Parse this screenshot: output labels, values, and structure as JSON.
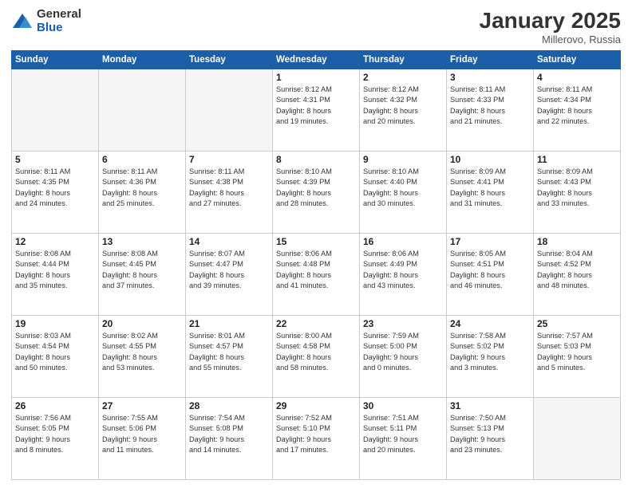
{
  "header": {
    "logo_general": "General",
    "logo_blue": "Blue",
    "month_title": "January 2025",
    "location": "Millerovo, Russia"
  },
  "days_of_week": [
    "Sunday",
    "Monday",
    "Tuesday",
    "Wednesday",
    "Thursday",
    "Friday",
    "Saturday"
  ],
  "weeks": [
    [
      {
        "day": "",
        "info": ""
      },
      {
        "day": "",
        "info": ""
      },
      {
        "day": "",
        "info": ""
      },
      {
        "day": "1",
        "info": "Sunrise: 8:12 AM\nSunset: 4:31 PM\nDaylight: 8 hours\nand 19 minutes."
      },
      {
        "day": "2",
        "info": "Sunrise: 8:12 AM\nSunset: 4:32 PM\nDaylight: 8 hours\nand 20 minutes."
      },
      {
        "day": "3",
        "info": "Sunrise: 8:11 AM\nSunset: 4:33 PM\nDaylight: 8 hours\nand 21 minutes."
      },
      {
        "day": "4",
        "info": "Sunrise: 8:11 AM\nSunset: 4:34 PM\nDaylight: 8 hours\nand 22 minutes."
      }
    ],
    [
      {
        "day": "5",
        "info": "Sunrise: 8:11 AM\nSunset: 4:35 PM\nDaylight: 8 hours\nand 24 minutes."
      },
      {
        "day": "6",
        "info": "Sunrise: 8:11 AM\nSunset: 4:36 PM\nDaylight: 8 hours\nand 25 minutes."
      },
      {
        "day": "7",
        "info": "Sunrise: 8:11 AM\nSunset: 4:38 PM\nDaylight: 8 hours\nand 27 minutes."
      },
      {
        "day": "8",
        "info": "Sunrise: 8:10 AM\nSunset: 4:39 PM\nDaylight: 8 hours\nand 28 minutes."
      },
      {
        "day": "9",
        "info": "Sunrise: 8:10 AM\nSunset: 4:40 PM\nDaylight: 8 hours\nand 30 minutes."
      },
      {
        "day": "10",
        "info": "Sunrise: 8:09 AM\nSunset: 4:41 PM\nDaylight: 8 hours\nand 31 minutes."
      },
      {
        "day": "11",
        "info": "Sunrise: 8:09 AM\nSunset: 4:43 PM\nDaylight: 8 hours\nand 33 minutes."
      }
    ],
    [
      {
        "day": "12",
        "info": "Sunrise: 8:08 AM\nSunset: 4:44 PM\nDaylight: 8 hours\nand 35 minutes."
      },
      {
        "day": "13",
        "info": "Sunrise: 8:08 AM\nSunset: 4:45 PM\nDaylight: 8 hours\nand 37 minutes."
      },
      {
        "day": "14",
        "info": "Sunrise: 8:07 AM\nSunset: 4:47 PM\nDaylight: 8 hours\nand 39 minutes."
      },
      {
        "day": "15",
        "info": "Sunrise: 8:06 AM\nSunset: 4:48 PM\nDaylight: 8 hours\nand 41 minutes."
      },
      {
        "day": "16",
        "info": "Sunrise: 8:06 AM\nSunset: 4:49 PM\nDaylight: 8 hours\nand 43 minutes."
      },
      {
        "day": "17",
        "info": "Sunrise: 8:05 AM\nSunset: 4:51 PM\nDaylight: 8 hours\nand 46 minutes."
      },
      {
        "day": "18",
        "info": "Sunrise: 8:04 AM\nSunset: 4:52 PM\nDaylight: 8 hours\nand 48 minutes."
      }
    ],
    [
      {
        "day": "19",
        "info": "Sunrise: 8:03 AM\nSunset: 4:54 PM\nDaylight: 8 hours\nand 50 minutes."
      },
      {
        "day": "20",
        "info": "Sunrise: 8:02 AM\nSunset: 4:55 PM\nDaylight: 8 hours\nand 53 minutes."
      },
      {
        "day": "21",
        "info": "Sunrise: 8:01 AM\nSunset: 4:57 PM\nDaylight: 8 hours\nand 55 minutes."
      },
      {
        "day": "22",
        "info": "Sunrise: 8:00 AM\nSunset: 4:58 PM\nDaylight: 8 hours\nand 58 minutes."
      },
      {
        "day": "23",
        "info": "Sunrise: 7:59 AM\nSunset: 5:00 PM\nDaylight: 9 hours\nand 0 minutes."
      },
      {
        "day": "24",
        "info": "Sunrise: 7:58 AM\nSunset: 5:02 PM\nDaylight: 9 hours\nand 3 minutes."
      },
      {
        "day": "25",
        "info": "Sunrise: 7:57 AM\nSunset: 5:03 PM\nDaylight: 9 hours\nand 5 minutes."
      }
    ],
    [
      {
        "day": "26",
        "info": "Sunrise: 7:56 AM\nSunset: 5:05 PM\nDaylight: 9 hours\nand 8 minutes."
      },
      {
        "day": "27",
        "info": "Sunrise: 7:55 AM\nSunset: 5:06 PM\nDaylight: 9 hours\nand 11 minutes."
      },
      {
        "day": "28",
        "info": "Sunrise: 7:54 AM\nSunset: 5:08 PM\nDaylight: 9 hours\nand 14 minutes."
      },
      {
        "day": "29",
        "info": "Sunrise: 7:52 AM\nSunset: 5:10 PM\nDaylight: 9 hours\nand 17 minutes."
      },
      {
        "day": "30",
        "info": "Sunrise: 7:51 AM\nSunset: 5:11 PM\nDaylight: 9 hours\nand 20 minutes."
      },
      {
        "day": "31",
        "info": "Sunrise: 7:50 AM\nSunset: 5:13 PM\nDaylight: 9 hours\nand 23 minutes."
      },
      {
        "day": "",
        "info": ""
      }
    ]
  ]
}
